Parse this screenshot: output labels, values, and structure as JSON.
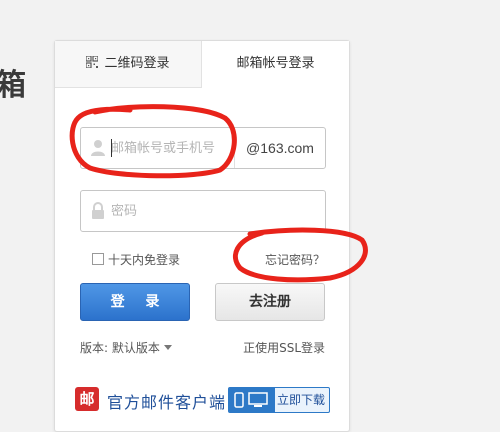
{
  "background": {
    "fragment": "箱"
  },
  "tabs": [
    {
      "label": "二维码登录",
      "icon": "qr-code-icon"
    },
    {
      "label": "邮箱帐号登录"
    }
  ],
  "form": {
    "username": {
      "placeholder": "邮箱帐号或手机号",
      "value": "",
      "domain": "@163.com",
      "icon": "user-icon"
    },
    "password": {
      "placeholder": "密码",
      "value": "",
      "icon": "lock-icon"
    },
    "remember_label": "十天内免登录",
    "forgot_label": "忘记密码？",
    "login_label": "登 录",
    "register_label": "去注册",
    "version_label": "版本: 默认版本",
    "ssl_label": "正使用SSL登录"
  },
  "client": {
    "logo_char": "邮",
    "title": "官方邮件客户端",
    "download_label": "立即下载"
  },
  "colors": {
    "accent": "#2c72cc",
    "annotation": "#e8231a"
  }
}
